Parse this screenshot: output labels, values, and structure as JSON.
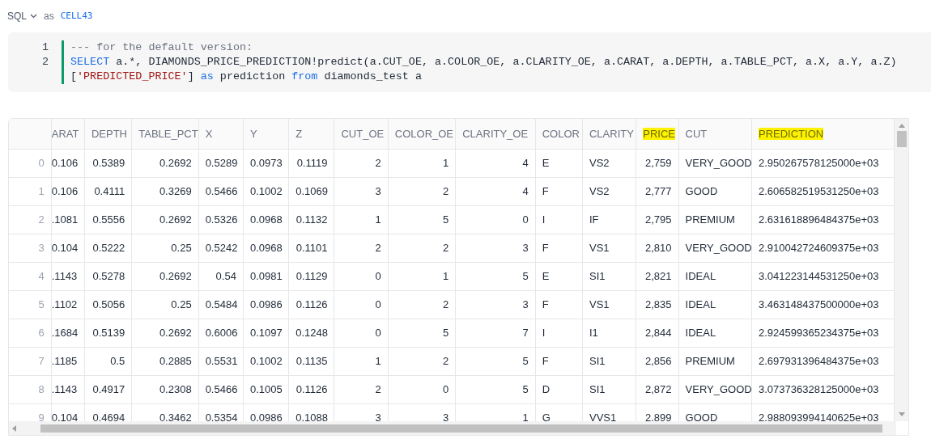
{
  "cell_header": {
    "language": "SQL",
    "as_label": "as",
    "cell_name": "CELL43"
  },
  "code": {
    "lines": [
      {
        "number": "1",
        "rows": [
          [
            {
              "kind": "comment",
              "text": "--- for the default version:"
            }
          ]
        ]
      },
      {
        "number": "2",
        "rows": [
          [
            {
              "kind": "keyword",
              "text": "SELECT"
            },
            {
              "kind": "plain",
              "text": " a.*, DIAMONDS_PRICE_PREDICTION!predict(a.CUT_OE, a.COLOR_OE, a.CLARITY_OE, a.CARAT, a.DEPTH, a.TABLE_PCT, a.X, a.Y, a.Z)"
            }
          ],
          [
            {
              "kind": "plain",
              "text": "["
            },
            {
              "kind": "string",
              "text": "'PREDICTED_PRICE'"
            },
            {
              "kind": "plain",
              "text": "] "
            },
            {
              "kind": "keyword",
              "text": "as"
            },
            {
              "kind": "plain",
              "text": " prediction "
            },
            {
              "kind": "keyword",
              "text": "from"
            },
            {
              "kind": "plain",
              "text": " diamonds_test a"
            }
          ]
        ]
      }
    ]
  },
  "table": {
    "columns": [
      {
        "label": "ARAT",
        "kind": "clipped",
        "highlighted": false
      },
      {
        "label": "DEPTH",
        "kind": "number",
        "highlighted": false
      },
      {
        "label": "TABLE_PCT",
        "kind": "number",
        "highlighted": false
      },
      {
        "label": "X",
        "kind": "number",
        "highlighted": false
      },
      {
        "label": "Y",
        "kind": "number",
        "highlighted": false
      },
      {
        "label": "Z",
        "kind": "number",
        "highlighted": false
      },
      {
        "label": "CUT_OE",
        "kind": "number",
        "highlighted": false
      },
      {
        "label": "COLOR_OE",
        "kind": "number",
        "highlighted": false
      },
      {
        "label": "CLARITY_OE",
        "kind": "number",
        "highlighted": false
      },
      {
        "label": "COLOR",
        "kind": "text",
        "highlighted": false
      },
      {
        "label": "CLARITY",
        "kind": "text",
        "highlighted": false
      },
      {
        "label": "PRICE",
        "kind": "number",
        "highlighted": true
      },
      {
        "label": "CUT",
        "kind": "text",
        "highlighted": false
      },
      {
        "label": "PREDICTION",
        "kind": "text",
        "highlighted": true
      }
    ],
    "rows": [
      {
        "index": "0",
        "cells": [
          "0.106",
          "0.5389",
          "0.2692",
          "0.5289",
          "0.0973",
          "0.1119",
          "2",
          "1",
          "4",
          "E",
          "VS2",
          "2,759",
          "VERY_GOOD",
          "2.950267578125000e+03"
        ]
      },
      {
        "index": "1",
        "cells": [
          "0.106",
          "0.4111",
          "0.3269",
          "0.5466",
          "0.1002",
          "0.1069",
          "3",
          "2",
          "4",
          "F",
          "VS2",
          "2,777",
          "GOOD",
          "2.606582519531250e+03"
        ]
      },
      {
        "index": "2",
        "cells": [
          ".1081",
          "0.5556",
          "0.2692",
          "0.5326",
          "0.0968",
          "0.1132",
          "1",
          "5",
          "0",
          "I",
          "IF",
          "2,795",
          "PREMIUM",
          "2.631618896484375e+03"
        ]
      },
      {
        "index": "3",
        "cells": [
          "0.104",
          "0.5222",
          "0.25",
          "0.5242",
          "0.0968",
          "0.1101",
          "2",
          "2",
          "3",
          "F",
          "VS1",
          "2,810",
          "VERY_GOOD",
          "2.910042724609375e+03"
        ]
      },
      {
        "index": "4",
        "cells": [
          ".1143",
          "0.5278",
          "0.2692",
          "0.54",
          "0.0981",
          "0.1129",
          "0",
          "1",
          "5",
          "E",
          "SI1",
          "2,821",
          "IDEAL",
          "3.041223144531250e+03"
        ]
      },
      {
        "index": "5",
        "cells": [
          ".1102",
          "0.5056",
          "0.25",
          "0.5484",
          "0.0986",
          "0.1126",
          "0",
          "2",
          "3",
          "F",
          "VS1",
          "2,835",
          "IDEAL",
          "3.463148437500000e+03"
        ]
      },
      {
        "index": "6",
        "cells": [
          ".1684",
          "0.5139",
          "0.2692",
          "0.6006",
          "0.1097",
          "0.1248",
          "0",
          "5",
          "7",
          "I",
          "I1",
          "2,844",
          "IDEAL",
          "2.924599365234375e+03"
        ]
      },
      {
        "index": "7",
        "cells": [
          ".1185",
          "0.5",
          "0.2885",
          "0.5531",
          "0.1002",
          "0.1135",
          "1",
          "2",
          "5",
          "F",
          "SI1",
          "2,856",
          "PREMIUM",
          "2.697931396484375e+03"
        ]
      },
      {
        "index": "8",
        "cells": [
          ".1143",
          "0.4917",
          "0.2308",
          "0.5466",
          "0.1005",
          "0.1126",
          "2",
          "0",
          "5",
          "D",
          "SI1",
          "2,872",
          "VERY_GOOD",
          "3.073736328125000e+03"
        ]
      },
      {
        "index": "9",
        "cells": [
          "0.104",
          "0.4694",
          "0.3462",
          "0.5354",
          "0.0986",
          "0.1088",
          "3",
          "3",
          "1",
          "G",
          "VVS1",
          "2,899",
          "GOOD",
          "2.988093994140625e+03"
        ]
      }
    ]
  }
}
